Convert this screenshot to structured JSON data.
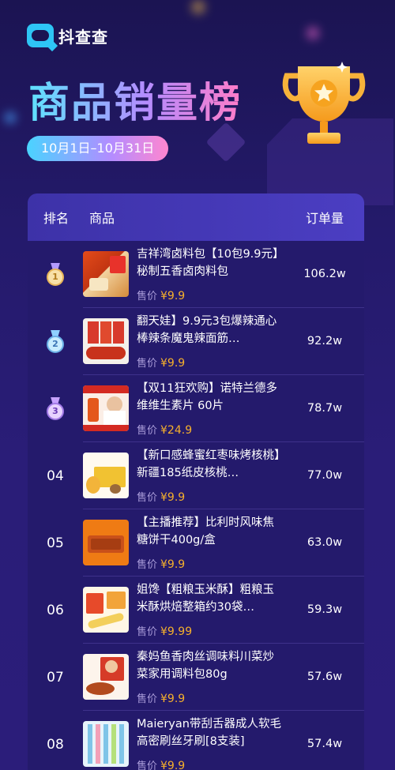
{
  "app": {
    "name": "抖查查"
  },
  "page": {
    "title": "商品销量榜",
    "date_range": "10月1日–10月31日"
  },
  "table": {
    "headers": {
      "rank": "排名",
      "goods": "商品",
      "orders": "订单量"
    },
    "price_prefix": "售价",
    "rows": [
      {
        "rank": "1",
        "name": "吉祥湾卤料包【10包9.9元】秘制五香卤肉料包",
        "price": "¥9.9",
        "orders": "106.2w"
      },
      {
        "rank": "2",
        "name": "翻天娃】9.9元3包爆辣通心棒辣条魔鬼辣面筋…",
        "price": "¥9.9",
        "orders": "92.2w"
      },
      {
        "rank": "3",
        "name": "【双11狂欢购】诺特兰德多维维生素片 60片",
        "price": "¥24.9",
        "orders": "78.7w"
      },
      {
        "rank": "04",
        "name": "【新口感蜂蜜红枣味烤核桃】新疆185纸皮核桃…",
        "price": "¥9.9",
        "orders": "77.0w"
      },
      {
        "rank": "05",
        "name": "【主播推荐】比利时风味焦糖饼干400g/盒",
        "price": "¥9.9",
        "orders": "63.0w"
      },
      {
        "rank": "06",
        "name": "姐馋【粗粮玉米酥】粗粮玉米酥烘焙整箱约30袋…",
        "price": "¥9.99",
        "orders": "59.3w"
      },
      {
        "rank": "07",
        "name": "秦妈鱼香肉丝调味料川菜炒菜家用调料包80g",
        "price": "¥9.9",
        "orders": "57.6w"
      },
      {
        "rank": "08",
        "name": "Maieryan带刮舌器成人软毛高密刷丝牙刷[8支装]",
        "price": "¥9.9",
        "orders": "57.4w"
      }
    ]
  },
  "colors": {
    "background": "#241a6b",
    "accent_price": "#f6b02c",
    "header_bar": "#4b3ec2"
  }
}
